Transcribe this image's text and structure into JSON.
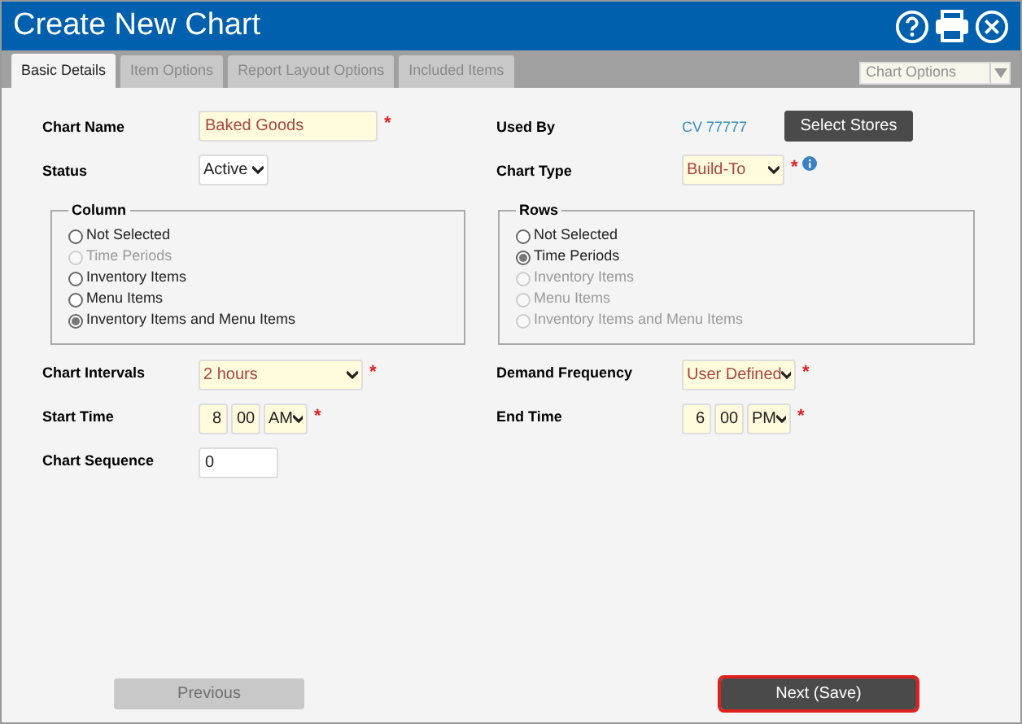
{
  "window": {
    "title": "Create New Chart"
  },
  "tabs": [
    {
      "label": "Basic Details",
      "selected": true,
      "disabled": false
    },
    {
      "label": "Item Options",
      "selected": false,
      "disabled": true
    },
    {
      "label": "Report Layout Options",
      "selected": false,
      "disabled": true
    },
    {
      "label": "Included Items",
      "selected": false,
      "disabled": true
    }
  ],
  "chart_options": {
    "placeholder": "Chart Options",
    "disabled": true
  },
  "chart_name": {
    "label": "Chart Name",
    "value": "Baked Goods",
    "required_mark": "*"
  },
  "status": {
    "label": "Status",
    "value": "Active"
  },
  "used_by": {
    "label": "Used By",
    "value": "CV 77777",
    "button": "Select Stores"
  },
  "chart_type": {
    "label": "Chart Type",
    "value": "Build-To",
    "required_mark": "*"
  },
  "column": {
    "legend": "Column",
    "options": [
      {
        "label": "Not Selected",
        "selected": false,
        "disabled": false
      },
      {
        "label": "Time Periods",
        "selected": false,
        "disabled": true
      },
      {
        "label": "Inventory Items",
        "selected": false,
        "disabled": false
      },
      {
        "label": "Menu Items",
        "selected": false,
        "disabled": false
      },
      {
        "label": "Inventory Items and Menu Items",
        "selected": true,
        "disabled": false
      }
    ]
  },
  "rows": {
    "legend": "Rows",
    "options": [
      {
        "label": "Not Selected",
        "selected": false,
        "disabled": false
      },
      {
        "label": "Time Periods",
        "selected": true,
        "disabled": false
      },
      {
        "label": "Inventory Items",
        "selected": false,
        "disabled": true
      },
      {
        "label": "Menu Items",
        "selected": false,
        "disabled": true
      },
      {
        "label": "Inventory Items and Menu Items",
        "selected": false,
        "disabled": true
      }
    ]
  },
  "chart_intervals": {
    "label": "Chart Intervals",
    "value": "2 hours",
    "required_mark": "*"
  },
  "demand_frequency": {
    "label": "Demand Frequency",
    "value": "User Defined",
    "required_mark": "*"
  },
  "start_time": {
    "label": "Start Time",
    "hour": "8",
    "minute": "00",
    "period": "AM",
    "required_mark": "*"
  },
  "end_time": {
    "label": "End Time",
    "hour": "6",
    "minute": "00",
    "period": "PM",
    "required_mark": "*"
  },
  "chart_sequence": {
    "label": "Chart Sequence",
    "value": "0"
  },
  "buttons": [
    {
      "label": "Previous",
      "disabled": true,
      "focused": false
    },
    {
      "label": "Next (Save)",
      "disabled": false,
      "focused": true
    }
  ]
}
